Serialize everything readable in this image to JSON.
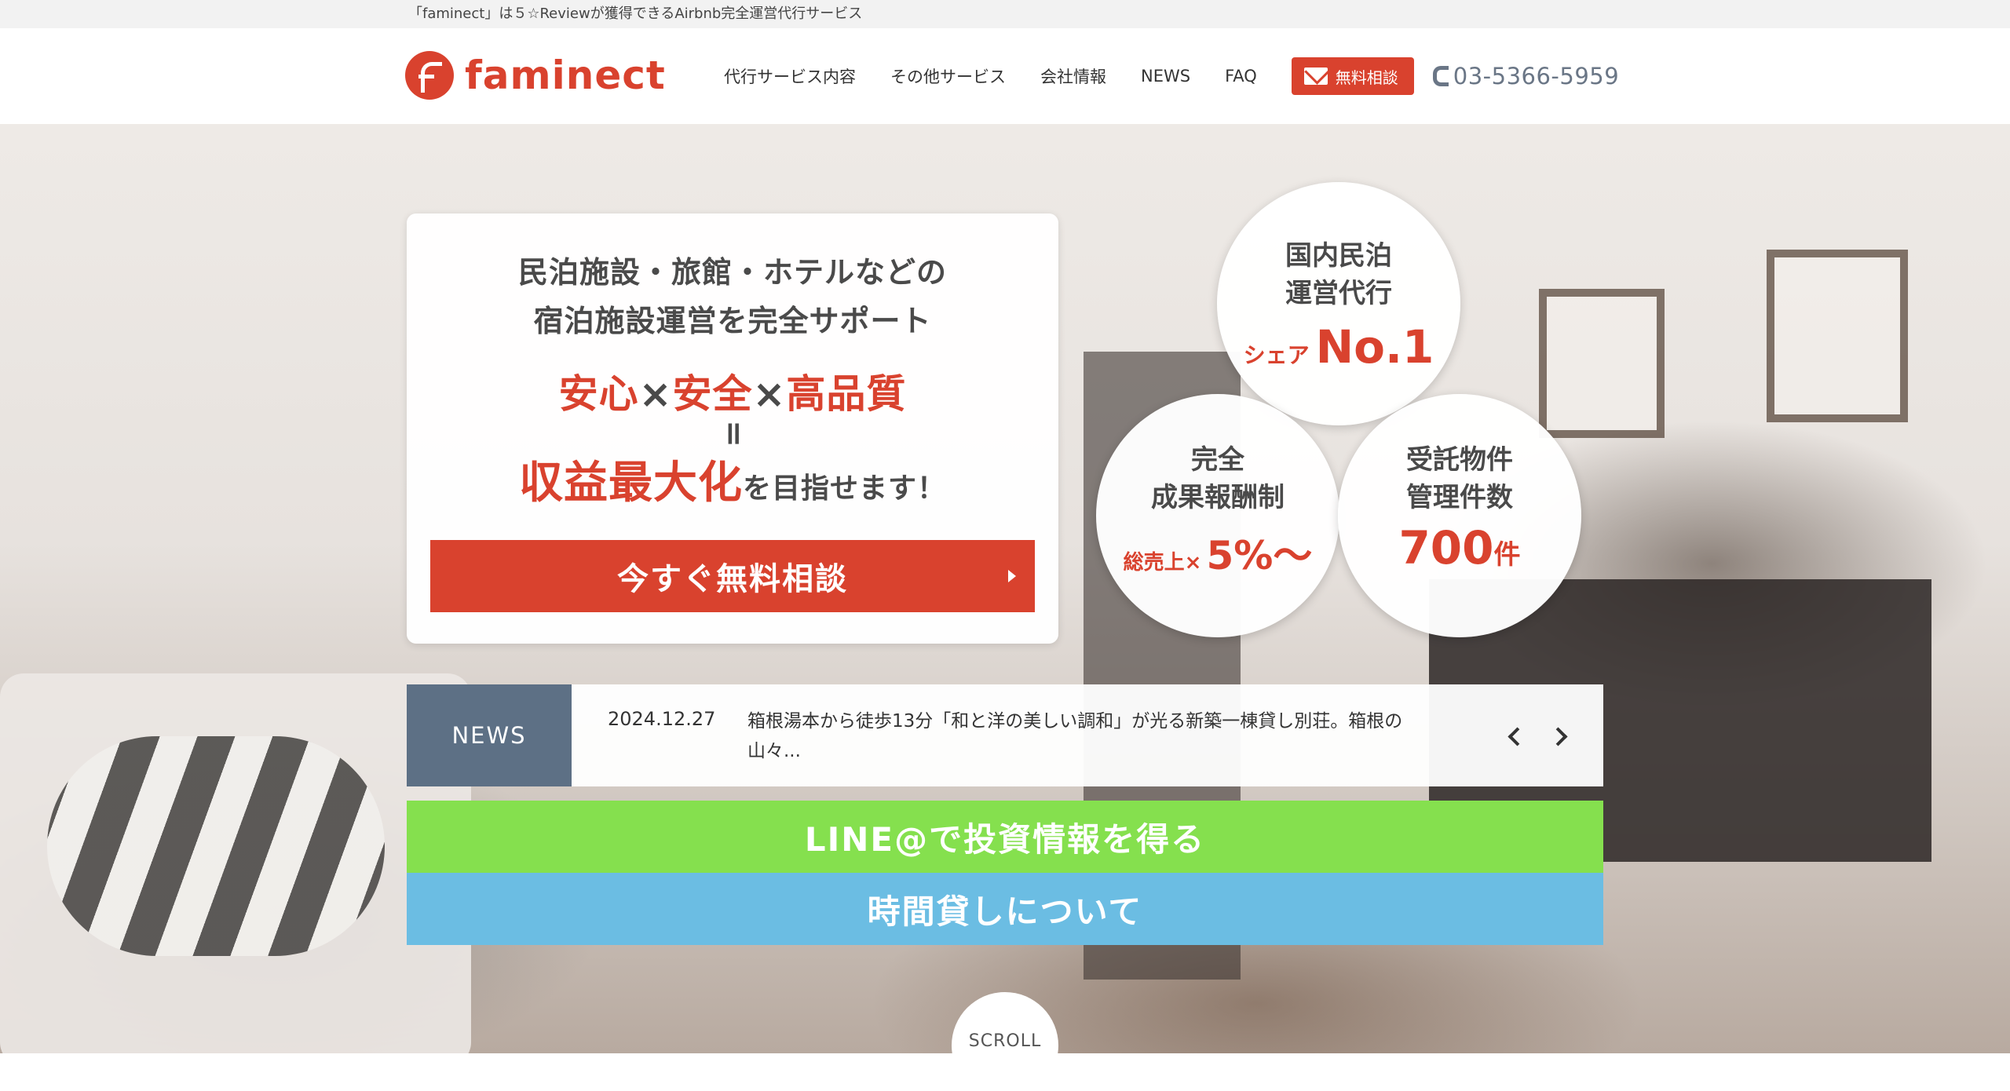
{
  "topbar": {
    "text": "「faminect」は５☆Reviewが獲得できるAirbnb完全運営代行サービス"
  },
  "header": {
    "logo_text": "faminect",
    "nav": [
      "代行サービス内容",
      "その他サービス",
      "会社情報",
      "NEWS",
      "FAQ"
    ],
    "cta_label": "無料相談",
    "phone": "03-5366-5959",
    "icons": {
      "mail": "mail-icon",
      "phone": "phone-icon"
    }
  },
  "hero": {
    "lead_line1": "民泊施設・旅館・ホテルなどの",
    "lead_line2": "宿泊施設運営を完全サポート",
    "values": [
      "安心",
      "×",
      "安全",
      "×",
      "高品質"
    ],
    "equals": "॥",
    "goal": "収益最大化",
    "goal_tail": "を目指せます！",
    "cta_button": "今すぐ無料相談"
  },
  "badges": [
    {
      "label1": "国内民泊",
      "label2": "運営代行",
      "prefix": "シェア",
      "value": "No.1"
    },
    {
      "label1": "完全",
      "label2": "成果報酬制",
      "prefix": "総売上×",
      "value": "5%〜"
    },
    {
      "label1": "受託物件",
      "label2": "管理件数",
      "value": "700",
      "suffix": "件"
    }
  ],
  "news": {
    "tag": "NEWS",
    "date": "2024.12.27",
    "text": "箱根湯本から徒歩13分「和と洋の美しい調和」が光る新築一棟貸し別荘。箱根の山々..."
  },
  "banners": {
    "line": "LINE@で投資情報を得る",
    "rental": "時間貸しについて"
  },
  "scroll": {
    "label": "SCROLL"
  },
  "colors": {
    "brand": "#d9422e",
    "news_tag": "#5d7085",
    "line_banner": "#85e04e",
    "rental_banner": "#6bbde3"
  }
}
